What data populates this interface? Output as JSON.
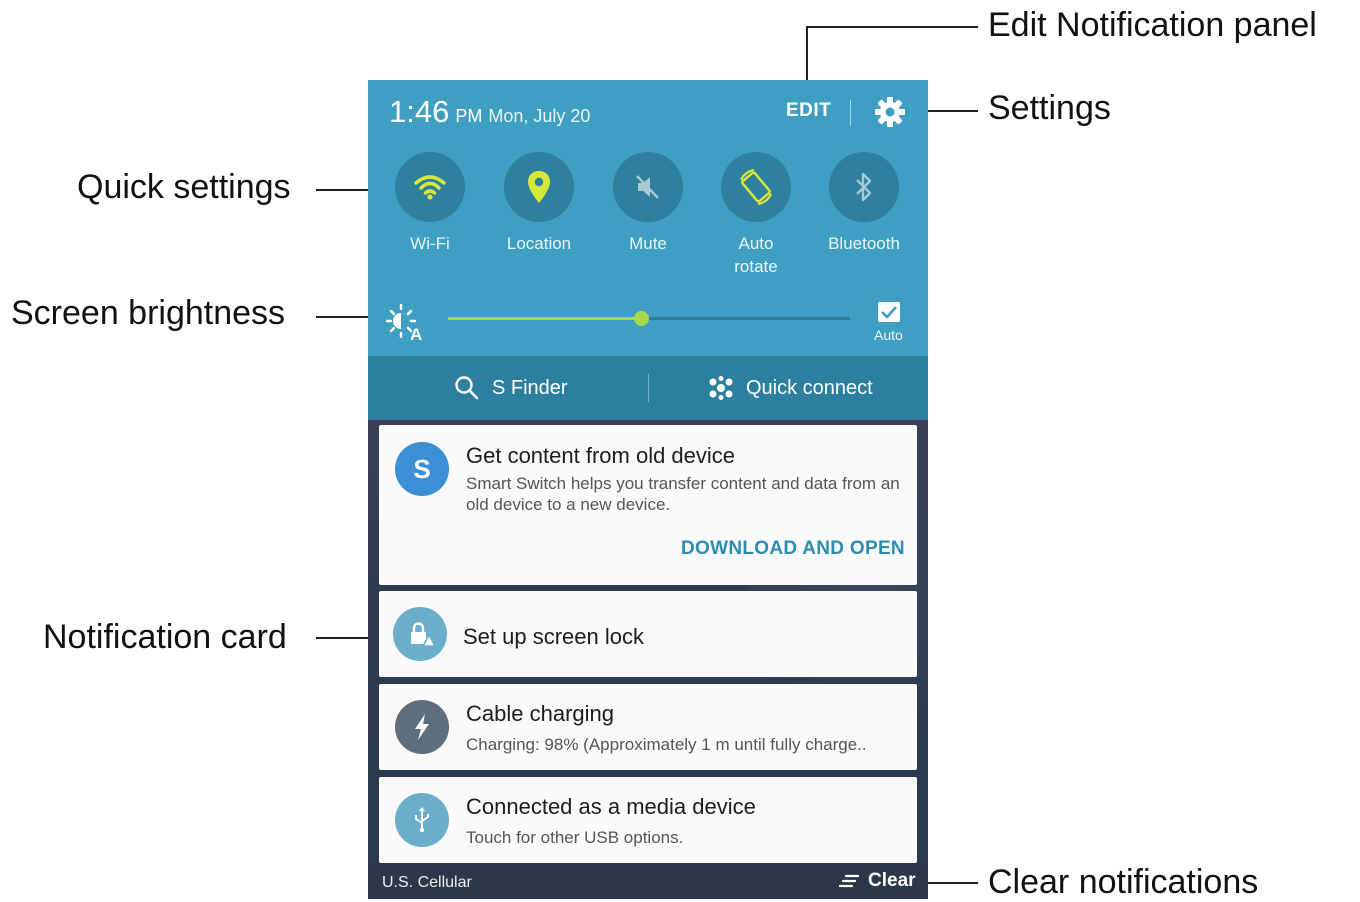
{
  "callouts": {
    "edit_panel": "Edit Notification panel",
    "settings": "Settings",
    "quick_settings": "Quick settings",
    "brightness": "Screen brightness",
    "notification_card": "Notification card",
    "clear": "Clear notifications"
  },
  "status": {
    "time": "1:46",
    "ampm": "PM",
    "date": "Mon, July 20",
    "edit": "EDIT"
  },
  "quick_tiles": [
    {
      "label": "Wi-Fi",
      "icon": "wifi-icon",
      "active": true
    },
    {
      "label": "Location",
      "icon": "location-pin-icon",
      "active": true
    },
    {
      "label": "Mute",
      "icon": "mute-icon",
      "active": false
    },
    {
      "label": "Auto rotate",
      "icon": "auto-rotate-icon",
      "active": true
    },
    {
      "label": "Bluetooth",
      "icon": "bluetooth-icon",
      "active": false
    }
  ],
  "brightness": {
    "level": 0.48,
    "auto_label": "Auto",
    "auto_checked": true
  },
  "finder": {
    "s_finder": "S Finder",
    "quick_connect": "Quick connect"
  },
  "notifications": [
    {
      "title": "Get content from old device",
      "body": "Smart Switch helps you transfer content and data from an old device to a new device.",
      "action": "DOWNLOAD AND OPEN",
      "icon": "smart-switch-icon"
    },
    {
      "title": "Set up screen lock",
      "icon": "screen-lock-icon"
    },
    {
      "title": "Cable charging",
      "body": "Charging: 98% (Approximately 1 m until fully charge..",
      "icon": "charging-icon"
    },
    {
      "title": "Connected as a media device",
      "body": "Touch for other USB options.",
      "icon": "usb-icon"
    }
  ],
  "footer": {
    "carrier": "U.S. Cellular",
    "clear": "Clear"
  },
  "colors": {
    "panel_blue": "#3e9fc3",
    "tile_circle": "#2f7f9e",
    "accent_green": "#a8d94a",
    "action_blue": "#2b8db4"
  }
}
